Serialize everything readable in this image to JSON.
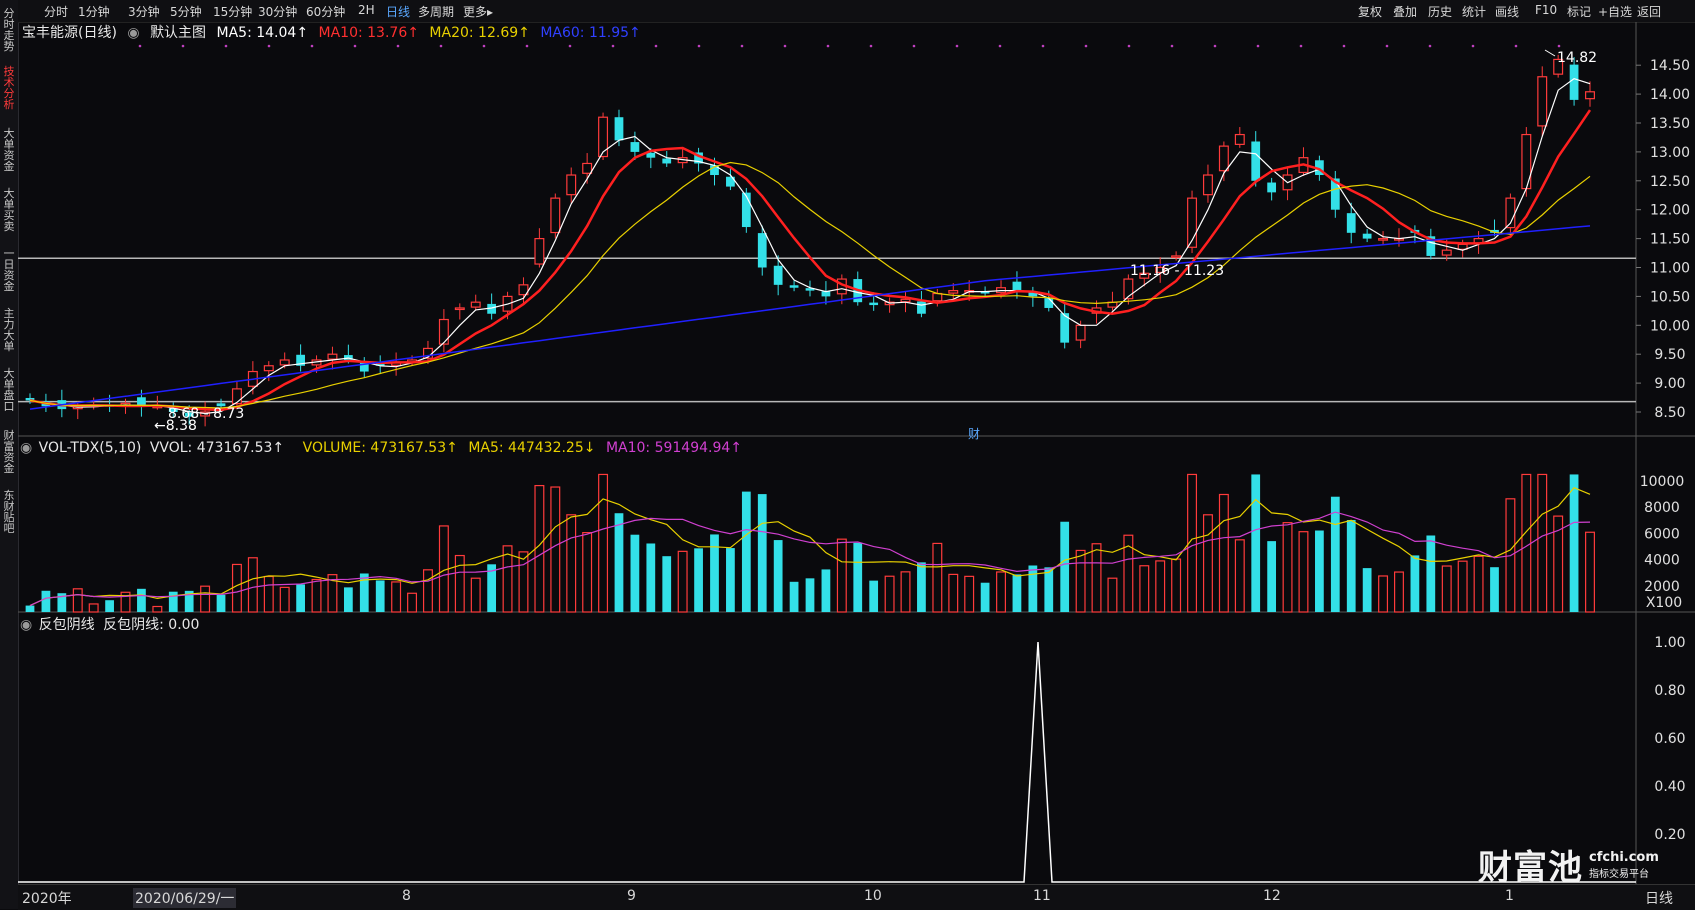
{
  "left_tabs": [
    {
      "label": "分时走势",
      "active": false
    },
    {
      "label": "技术分析",
      "active": true
    },
    {
      "label": "大单资金",
      "active": false
    },
    {
      "label": "大单买卖",
      "active": false
    },
    {
      "label": "一日资金",
      "active": false
    },
    {
      "label": "主力大单",
      "active": false
    },
    {
      "label": "大单盘口",
      "active": false
    },
    {
      "label": "财富资金",
      "active": false
    },
    {
      "label": "东财贴吧",
      "active": false
    }
  ],
  "period_tabs": [
    "分时",
    "1分钟",
    "3分钟",
    "5分钟",
    "15分钟",
    "30分钟",
    "60分钟",
    "2H",
    "日线",
    "多周期",
    "更多▸"
  ],
  "active_period": "日线",
  "right_tools": [
    "复权",
    "叠加",
    "历史",
    "统计",
    "画线",
    "F10",
    "标记",
    "+自选",
    "返回"
  ],
  "main_legend": {
    "title": "宝丰能源(日线)",
    "indicator": "默认主图",
    "ma5": "MA5: 14.04↑",
    "ma10": "MA10: 13.76↑",
    "ma20": "MA20: 12.69↑",
    "ma60": "MA60: 11.95↑"
  },
  "vol_legend": {
    "name": "VOL-TDX(5,10)",
    "vvol": "VVOL: 473167.53↑",
    "volume": "VOLUME: 473167.53↑",
    "ma5": "MA5: 447432.25↓",
    "ma10": "MA10: 591494.94↑"
  },
  "ind_legend": {
    "name": "反包阴线",
    "value": "反包阴线: 0.00"
  },
  "annotations": {
    "high_label": "14.82",
    "low_label": "8.38",
    "range1": "8.68 - 8.73",
    "range2": "11.16 - 11.23",
    "marker": "财"
  },
  "date_labels": [
    {
      "text": "2020年"
    },
    {
      "text": "2020/06/29/一"
    },
    {
      "text": "8"
    },
    {
      "text": "9"
    },
    {
      "text": "10"
    },
    {
      "text": "11"
    },
    {
      "text": "12"
    },
    {
      "text": "1"
    }
  ],
  "bottom_right": "日线",
  "logo": {
    "brand": "财富池",
    "domain": "cfchi.com",
    "tagline": "指标交易平台"
  },
  "colors": {
    "up": "#ff3b3b",
    "down": "#33e0e8",
    "ma5": "#ffffff",
    "ma10": "#ff2020",
    "ma20": "#e8d000",
    "ma60": "#2020ff",
    "vma10": "#d040d0",
    "active_tab": "#5aa8ff"
  },
  "chart_data": [
    {
      "type": "candlestick",
      "title": "宝丰能源(日线)",
      "y_ticks": [
        8.5,
        9.0,
        9.5,
        10.0,
        10.5,
        11.0,
        11.5,
        12.0,
        12.5,
        13.0,
        13.5,
        14.0,
        14.5
      ],
      "ylim": [
        8.3,
        14.9
      ],
      "x_labels": [
        "2020年",
        "8",
        "9",
        "10",
        "11",
        "12",
        "1"
      ],
      "reference_lines": [
        8.68,
        11.16
      ],
      "series_close": [
        8.7,
        8.6,
        8.55,
        8.6,
        8.62,
        8.6,
        8.65,
        8.6,
        8.6,
        8.5,
        8.42,
        8.5,
        8.6,
        8.9,
        9.2,
        9.3,
        9.4,
        9.3,
        9.4,
        9.5,
        9.4,
        9.2,
        9.3,
        9.35,
        9.4,
        9.6,
        10.1,
        10.3,
        10.4,
        10.2,
        10.5,
        10.7,
        11.5,
        12.2,
        12.6,
        12.8,
        13.6,
        13.2,
        13.0,
        12.9,
        12.8,
        12.9,
        12.8,
        12.6,
        12.4,
        11.7,
        11.0,
        10.7,
        10.65,
        10.6,
        10.5,
        10.8,
        10.4,
        10.35,
        10.4,
        10.45,
        10.2,
        10.55,
        10.6,
        10.6,
        10.55,
        10.65,
        10.6,
        10.5,
        10.3,
        9.7,
        10.0,
        10.3,
        10.4,
        10.8,
        10.9,
        11.0,
        11.2,
        12.2,
        12.6,
        13.1,
        13.3,
        12.5,
        12.3,
        12.6,
        12.9,
        12.6,
        12.0,
        11.6,
        11.5,
        11.5,
        11.5,
        11.6,
        11.2,
        11.3,
        11.4,
        11.5,
        11.6,
        12.2,
        13.3,
        14.3,
        14.6,
        13.9,
        14.04
      ]
    },
    {
      "type": "bar",
      "title": "VOL-TDX(5,10)",
      "unit": "X100",
      "y_ticks": [
        2000,
        4000,
        6000,
        8000,
        10000
      ],
      "ylim": [
        0,
        11000
      ]
    },
    {
      "type": "line",
      "title": "反包阴线",
      "y_ticks": [
        0.2,
        0.4,
        0.6,
        0.8,
        1.0
      ],
      "ylim": [
        0,
        1.05
      ],
      "spike_x_label": "11",
      "spike_value": 1.0,
      "base_value": 0.0
    }
  ]
}
